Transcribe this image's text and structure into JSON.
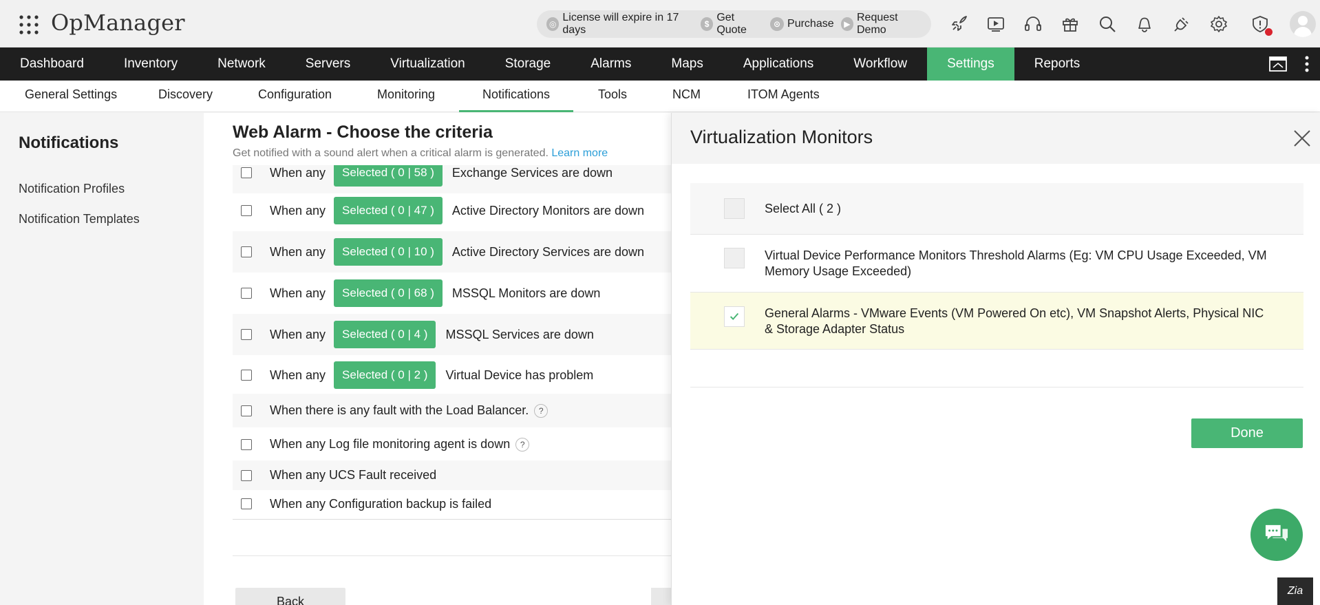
{
  "app": {
    "title": "OpManager"
  },
  "license": {
    "expire_text": "License will expire in 17 days",
    "get_quote": "Get Quote",
    "purchase": "Purchase",
    "request_demo": "Request Demo"
  },
  "main_nav": {
    "items": [
      "Dashboard",
      "Inventory",
      "Network",
      "Servers",
      "Virtualization",
      "Storage",
      "Alarms",
      "Maps",
      "Applications",
      "Workflow",
      "Settings",
      "Reports"
    ],
    "active": "Settings"
  },
  "sub_nav": {
    "items": [
      "General Settings",
      "Discovery",
      "Configuration",
      "Monitoring",
      "Notifications",
      "Tools",
      "NCM",
      "ITOM Agents"
    ],
    "active": "Notifications"
  },
  "sidebar": {
    "title": "Notifications",
    "links": [
      "Notification Profiles",
      "Notification Templates"
    ]
  },
  "content": {
    "title": "Web Alarm - Choose the criteria",
    "subtitle": "Get notified with a sound alert when a critical alarm is generated.",
    "learn_more": "Learn more",
    "criteria": [
      {
        "prefix": "When any",
        "selected": "Selected ( 0 | 58 )",
        "text": "Exchange Services are down"
      },
      {
        "prefix": "When any",
        "selected": "Selected ( 0 | 47 )",
        "text": "Active Directory Monitors are down"
      },
      {
        "prefix": "When any",
        "selected": "Selected ( 0 | 10 )",
        "text": "Active Directory Services are down"
      },
      {
        "prefix": "When any",
        "selected": "Selected ( 0 | 68 )",
        "text": "MSSQL Monitors are down"
      },
      {
        "prefix": "When any",
        "selected": "Selected ( 0 | 4 )",
        "text": "MSSQL Services are down"
      },
      {
        "prefix": "When any",
        "selected": "Selected ( 0 | 2 )",
        "text": "Virtual Device has problem"
      },
      {
        "text": "When there is any fault with the Load Balancer.",
        "help": "?"
      },
      {
        "text": "When any Log file monitoring agent is down",
        "help": "?"
      },
      {
        "text": "When any UCS Fault received"
      },
      {
        "text": "When any Configuration backup is failed"
      }
    ],
    "back_label": "Back"
  },
  "drawer": {
    "title": "Virtualization Monitors",
    "select_all": "Select All ( 2 )",
    "options": [
      {
        "label": "Virtual Device Performance Monitors Threshold Alarms (Eg: VM CPU Usage Exceeded, VM Memory Usage Exceeded)",
        "checked": false
      },
      {
        "label": "General Alarms - VMware Events (VM Powered On etc), VM Snapshot Alerts, Physical NIC & Storage Adapter Status",
        "checked": true
      }
    ],
    "done_label": "Done",
    "zia_label": "Zia"
  },
  "colors": {
    "accent": "#49b675",
    "nav_bg": "#1f1f1f",
    "link": "#2b9ed8",
    "highlight_row": "#fbfbe3"
  }
}
